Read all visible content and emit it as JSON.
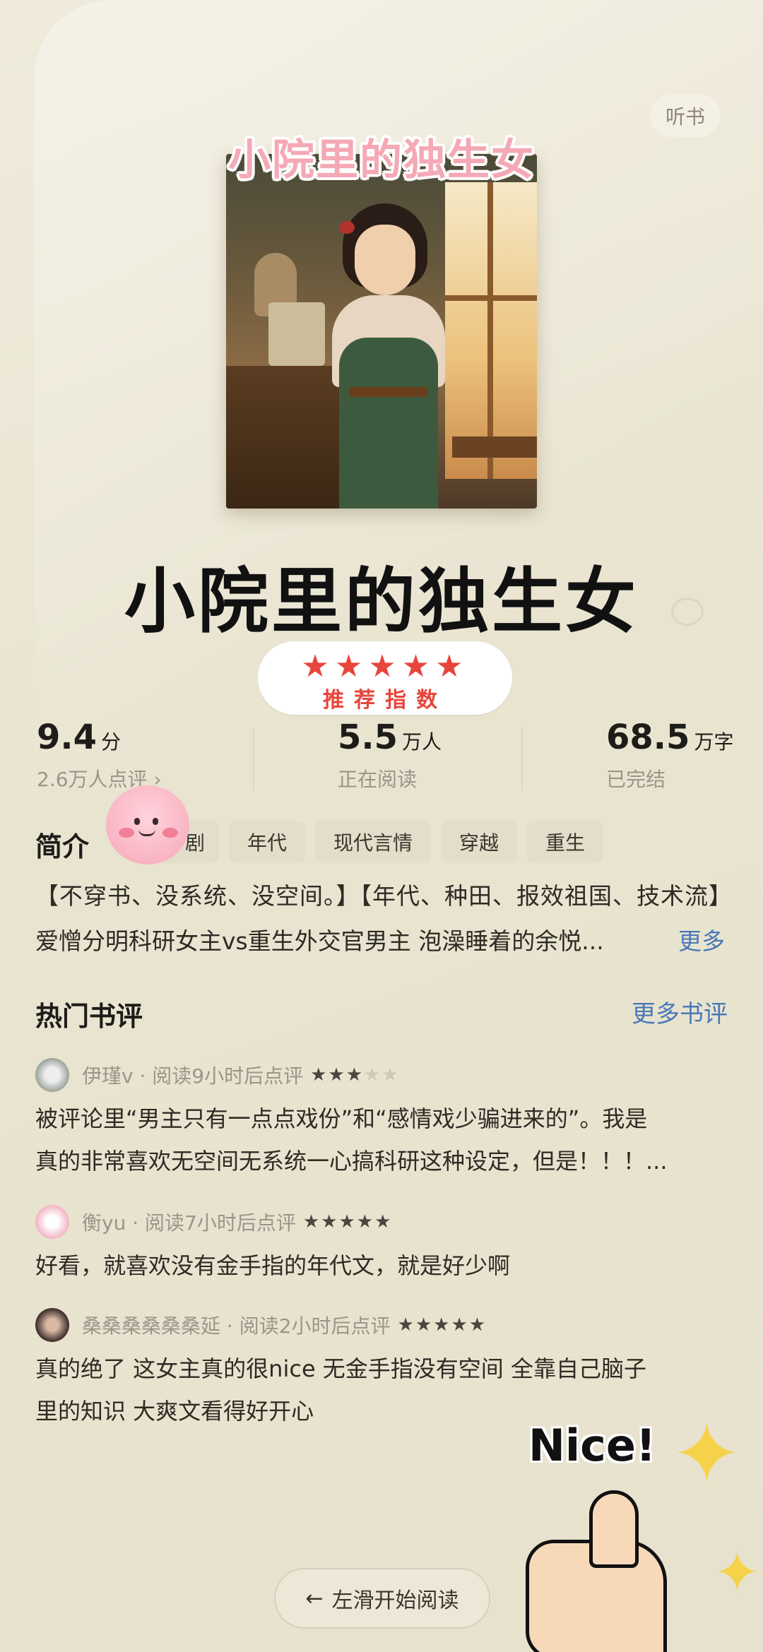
{
  "listen_button": "听书",
  "cover": {
    "art_title": "小院里的独生女"
  },
  "book_title": "小院里的独生女",
  "recommend": {
    "stars": "★★★★★",
    "label": "推荐指数"
  },
  "stats": {
    "score": {
      "value": "9.4",
      "unit": "分",
      "sub": "2.6万人点评 ›"
    },
    "readers": {
      "value": "5.5",
      "unit": "万人",
      "sub": "正在阅读"
    },
    "words": {
      "value": "68.5",
      "unit": "万字",
      "sub": "已完结"
    }
  },
  "intro": {
    "heading": "简介",
    "tags": [
      "剧",
      "年代",
      "现代言情",
      "穿越",
      "重生"
    ],
    "line1": "【不穿书、没系统、没空间。】【年代、种田、报效祖国、技术流】",
    "line2": "爱憎分明科研女主vs重生外交官男主 泡澡睡着的余悦...",
    "more": "更多"
  },
  "reviews": {
    "heading": "热门书评",
    "more": "更多书评",
    "items": [
      {
        "meta": "伊瑾v · 阅读9小时后点评",
        "rating": 3,
        "line1": "被评论里“男主只有一点点戏份”和“感情戏少骗进来的”。我是",
        "line2": "真的非常喜欢无空间无系统一心搞科研这种设定，但是！！！..."
      },
      {
        "meta": "衡yu · 阅读7小时后点评",
        "rating": 5,
        "line1": "好看，就喜欢没有金手指的年代文，就是好少啊",
        "line2": ""
      },
      {
        "meta": "桑桑桑桑桑桑延 · 阅读2小时后点评",
        "rating": 5,
        "line1": "真的绝了 这女主真的很nice 无金手指没有空间 全靠自己脑子",
        "line2": "里的知识 大爽文看得好开心"
      }
    ]
  },
  "sticker_text": "Nice!",
  "swipe_button": "左滑开始阅读",
  "colors": {
    "background": "#ebe6d3",
    "link": "#4a78b8",
    "star_red": "#e8453c"
  }
}
